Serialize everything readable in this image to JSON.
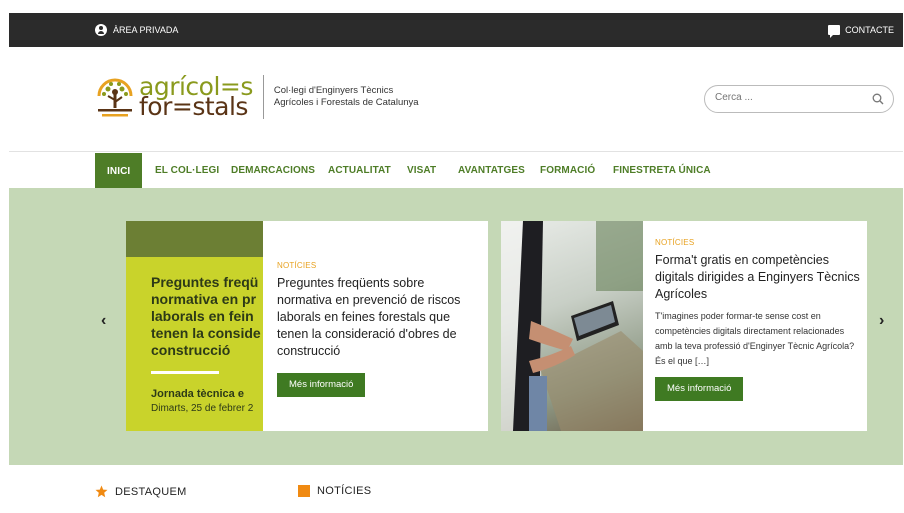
{
  "topbar": {
    "private_area": "ÀREA PRIVADA",
    "contact": "CONTACTE"
  },
  "header": {
    "logo_line1": "agrícol=s",
    "logo_line2": "for=stals",
    "org_name_line1": "Col·legi d'Enginyers Tècnics",
    "org_name_line2": "Agrícoles i Forestals de Catalunya",
    "search_placeholder": "Cerca ..."
  },
  "nav": {
    "items": [
      {
        "label": "INICI",
        "active": true
      },
      {
        "label": "EL COL·LEGI"
      },
      {
        "label": "DEMARCACIONS"
      },
      {
        "label": "ACTUALITAT"
      },
      {
        "label": "VISAT"
      },
      {
        "label": "AVANTATGES"
      },
      {
        "label": "FORMACIÓ"
      },
      {
        "label": "FINESTRETA ÚNICA"
      }
    ]
  },
  "slider": {
    "prev_icon": "chevron-left-icon",
    "next_icon": "chevron-right-icon",
    "slides": [
      {
        "kicker": "NOTÍCIES",
        "title": "Preguntes freqüents sobre normativa en prevenció de riscos laborals en feines forestals que tenen la consideració d'obres de construcció",
        "button": "Més informació",
        "poster_lines": [
          "Preguntes freqü",
          "normativa en pr",
          "laborals en fein",
          "tenen la conside",
          "construcció"
        ],
        "poster_event": "Jornada tècnica e",
        "poster_date": "Dimarts, 25 de febrer 2"
      },
      {
        "kicker": "NOTÍCIES",
        "title": "Forma't gratis en competències digitals dirigides a Enginyers Tècnics Agrícoles",
        "excerpt": "T'imagines poder formar-te sense cost en competències digitals directament relacionades amb la teva professió d'Enginyer Tècnic Agrícola? És el que […]",
        "button": "Més informació"
      }
    ]
  },
  "sections": {
    "featured": "DESTAQUEM",
    "news": "NOTÍCIES"
  },
  "colors": {
    "topbar": "#2b2b2b",
    "brand_green": "#4e7d27",
    "slider_bg": "#c5d8b6",
    "accent_orange": "#f08a12",
    "kicker": "#e8a221"
  }
}
